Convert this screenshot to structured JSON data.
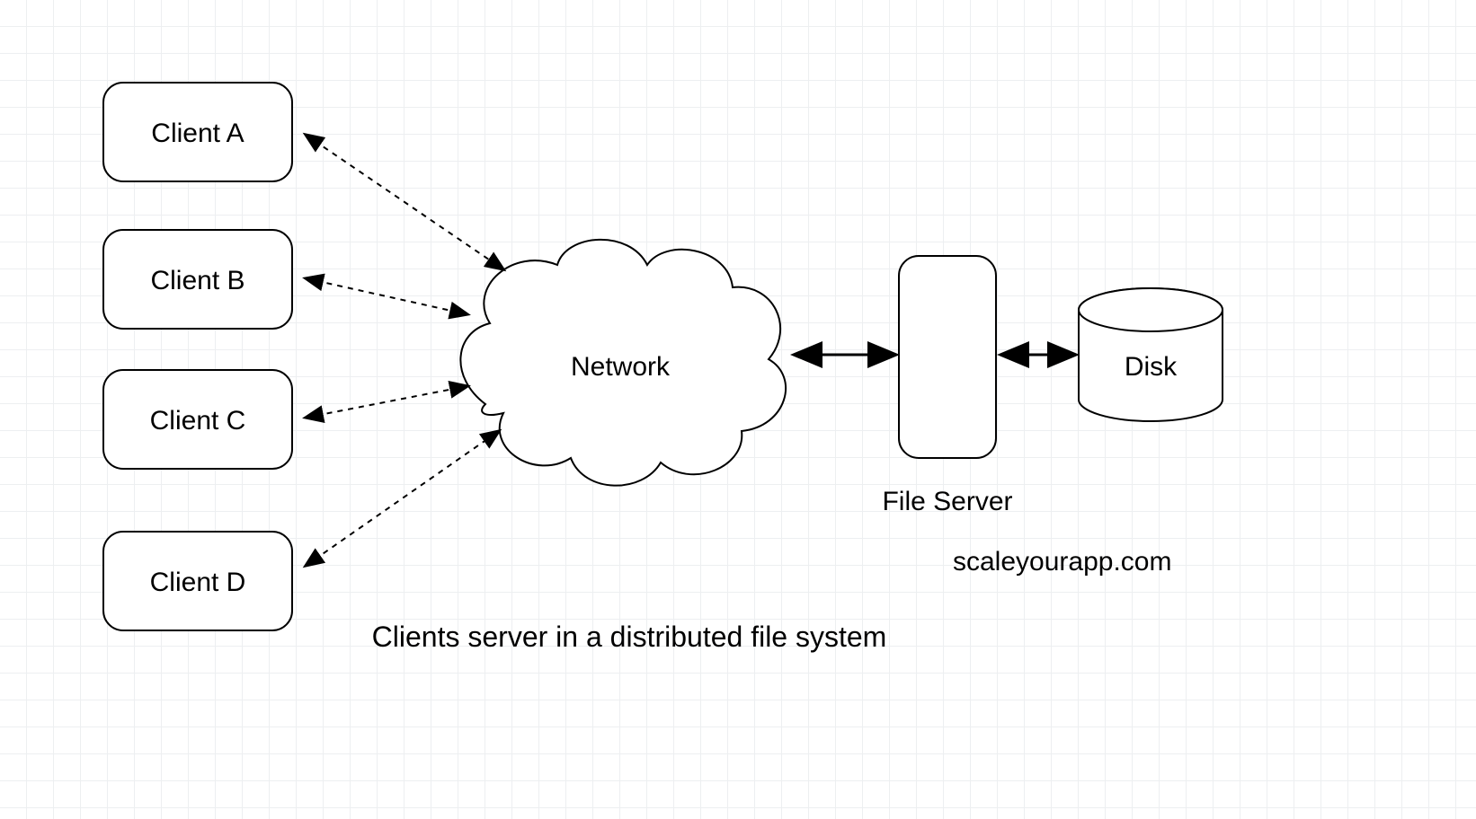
{
  "clients": [
    {
      "label": "Client A"
    },
    {
      "label": "Client B"
    },
    {
      "label": "Client C"
    },
    {
      "label": "Client D"
    }
  ],
  "network": {
    "label": "Network"
  },
  "fileServer": {
    "label": "File Server"
  },
  "disk": {
    "label": "Disk"
  },
  "caption": "Clients server in a distributed file system",
  "watermark": "scaleyourapp.com"
}
